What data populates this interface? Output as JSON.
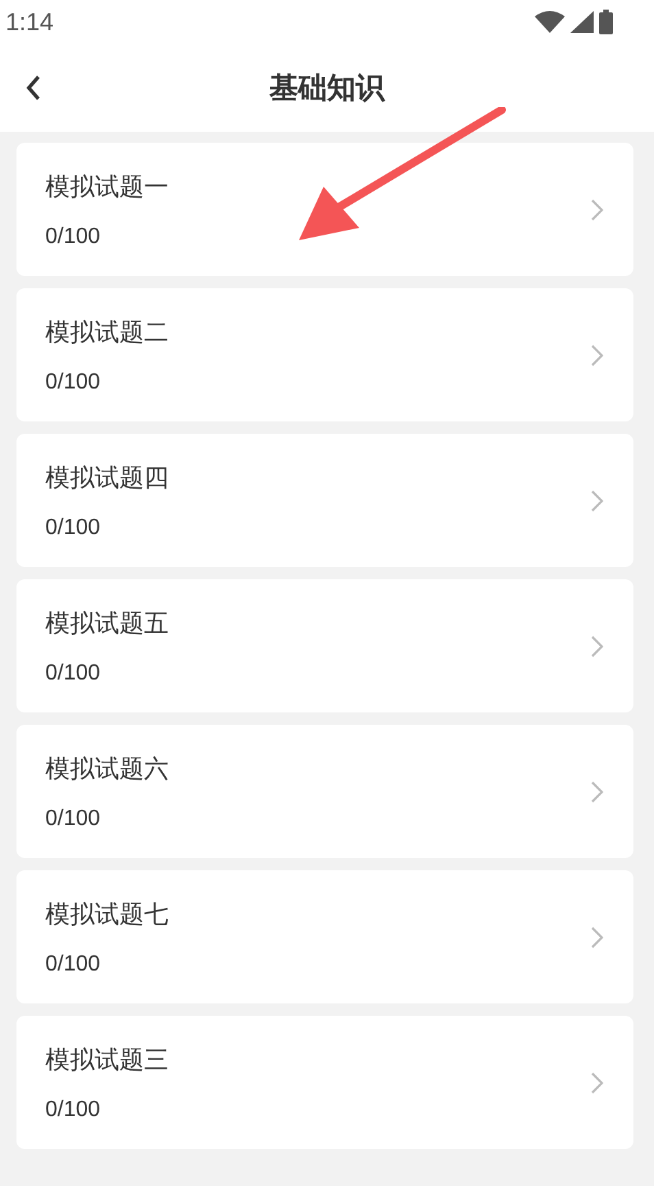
{
  "status_bar": {
    "time": "1:14"
  },
  "header": {
    "title": "基础知识"
  },
  "items": [
    {
      "title": "模拟试题一",
      "score": "0/100"
    },
    {
      "title": "模拟试题二",
      "score": "0/100"
    },
    {
      "title": "模拟试题四",
      "score": "0/100"
    },
    {
      "title": "模拟试题五",
      "score": "0/100"
    },
    {
      "title": "模拟试题六",
      "score": "0/100"
    },
    {
      "title": "模拟试题七",
      "score": "0/100"
    },
    {
      "title": "模拟试题三",
      "score": "0/100"
    }
  ]
}
